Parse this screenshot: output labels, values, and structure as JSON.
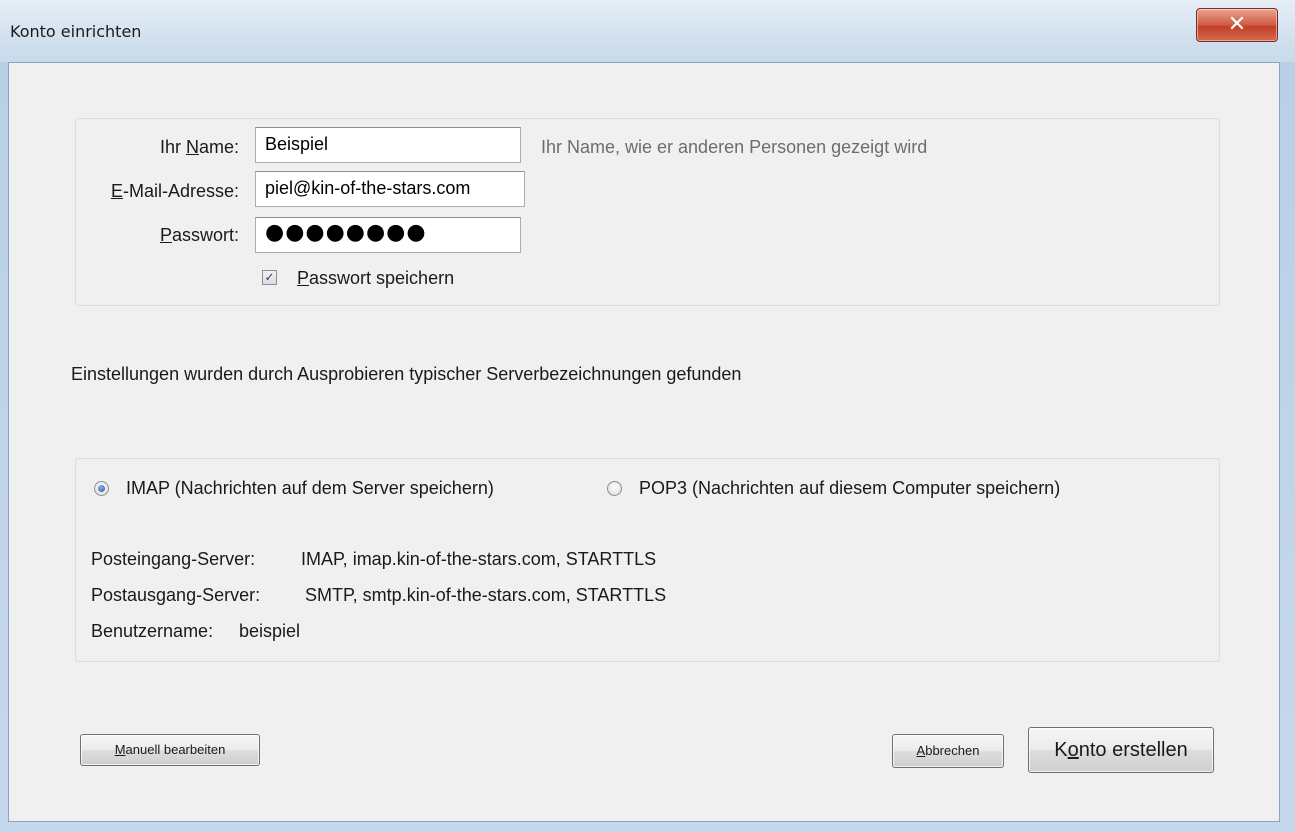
{
  "window": {
    "title": "Konto einrichten",
    "close_symbol": "✕"
  },
  "identity": {
    "name_label_pre": "Ihr ",
    "name_label_key": "N",
    "name_label_post": "ame:",
    "name_value": "Beispiel",
    "name_hint": "Ihr Name, wie er anderen Personen gezeigt wird",
    "email_label_key": "E",
    "email_label_post": "-Mail-Adresse:",
    "email_value": "piel@kin-of-the-stars.com",
    "password_label_key": "P",
    "password_label_post": "asswort:",
    "password_value": "●●●●●●●●",
    "remember_checked": true,
    "remember_check_glyph": "✓",
    "remember_label_key": "P",
    "remember_label_post": "asswort speichern"
  },
  "status_message": "Einstellungen wurden durch Ausprobieren typischer Serverbezeichnungen gefunden",
  "protocol": {
    "imap_label": "IMAP (Nachrichten auf dem Server speichern)",
    "pop3_label": "POP3 (Nachrichten auf diesem Computer speichern)",
    "selected": "IMAP"
  },
  "servers": {
    "incoming_label": "Posteingang-Server:",
    "incoming_value": "IMAP, imap.kin-of-the-stars.com, STARTTLS",
    "outgoing_label": "Postausgang-Server:",
    "outgoing_value": "SMTP, smtp.kin-of-the-stars.com, STARTTLS",
    "username_label": "Benutzername:",
    "username_value": "beispiel"
  },
  "buttons": {
    "manual_key": "M",
    "manual_post": "anuell bearbeiten",
    "cancel_key": "A",
    "cancel_post": "bbrechen",
    "create_pre": "K",
    "create_key": "o",
    "create_post": "nto erstellen"
  }
}
